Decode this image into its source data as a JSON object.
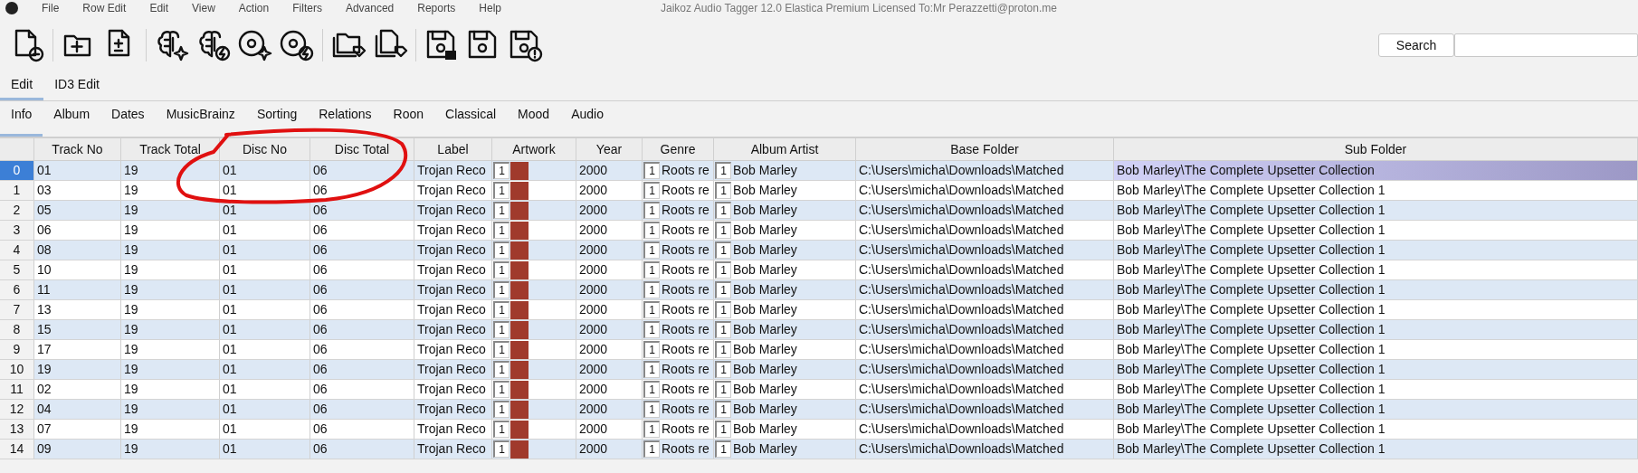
{
  "menu_bar": {
    "items": [
      "File",
      "Row Edit",
      "Edit",
      "View",
      "Action",
      "Filters",
      "Advanced",
      "Reports",
      "Help"
    ]
  },
  "window": {
    "title": "Jaikoz Audio Tagger 12.0 Elastica Premium Licensed To:Mr Perazzetti@proton.me"
  },
  "search": {
    "button": "Search"
  },
  "tabs": [
    {
      "label": "Edit",
      "selected": true
    },
    {
      "label": "ID3 Edit",
      "selected": false
    }
  ],
  "subtabs": [
    {
      "label": "Info",
      "selected": true
    },
    {
      "label": "Album",
      "selected": false
    },
    {
      "label": "Dates",
      "selected": false
    },
    {
      "label": "MusicBrainz",
      "selected": false
    },
    {
      "label": "Sorting",
      "selected": false
    },
    {
      "label": "Relations",
      "selected": false
    },
    {
      "label": "Roon",
      "selected": false
    },
    {
      "label": "Classical",
      "selected": false
    },
    {
      "label": "Mood",
      "selected": false
    },
    {
      "label": "Audio",
      "selected": false
    }
  ],
  "table": {
    "columns": [
      "Track No",
      "Track Total",
      "Disc No",
      "Disc Total",
      "Label",
      "Artwork",
      "Year",
      "Genre",
      "Album Artist",
      "Base Folder",
      "Sub Folder"
    ],
    "rows": [
      {
        "number": "0",
        "track_no": "01",
        "track_total": "19",
        "disc_no": "01",
        "disc_total": "06",
        "label": "Trojan Reco",
        "artwork_count": "1",
        "year": "2000",
        "genre_count": "1",
        "genre": "Roots re",
        "album_artist_count": "1",
        "album_artist": "Bob Marley",
        "base_folder": "C:\\Users\\micha\\Downloads\\Matched",
        "sub_folder": "Bob Marley\\The Complete Upsetter Collection",
        "selected": true
      },
      {
        "number": "1",
        "track_no": "03",
        "track_total": "19",
        "disc_no": "01",
        "disc_total": "06",
        "label": "Trojan Reco",
        "artwork_count": "1",
        "year": "2000",
        "genre_count": "1",
        "genre": "Roots re",
        "album_artist_count": "1",
        "album_artist": "Bob Marley",
        "base_folder": "C:\\Users\\micha\\Downloads\\Matched",
        "sub_folder": "Bob Marley\\The Complete Upsetter Collection 1",
        "selected": false
      },
      {
        "number": "2",
        "track_no": "05",
        "track_total": "19",
        "disc_no": "01",
        "disc_total": "06",
        "label": "Trojan Reco",
        "artwork_count": "1",
        "year": "2000",
        "genre_count": "1",
        "genre": "Roots re",
        "album_artist_count": "1",
        "album_artist": "Bob Marley",
        "base_folder": "C:\\Users\\micha\\Downloads\\Matched",
        "sub_folder": "Bob Marley\\The Complete Upsetter Collection 1",
        "selected": false
      },
      {
        "number": "3",
        "track_no": "06",
        "track_total": "19",
        "disc_no": "01",
        "disc_total": "06",
        "label": "Trojan Reco",
        "artwork_count": "1",
        "year": "2000",
        "genre_count": "1",
        "genre": "Roots re",
        "album_artist_count": "1",
        "album_artist": "Bob Marley",
        "base_folder": "C:\\Users\\micha\\Downloads\\Matched",
        "sub_folder": "Bob Marley\\The Complete Upsetter Collection 1",
        "selected": false
      },
      {
        "number": "4",
        "track_no": "08",
        "track_total": "19",
        "disc_no": "01",
        "disc_total": "06",
        "label": "Trojan Reco",
        "artwork_count": "1",
        "year": "2000",
        "genre_count": "1",
        "genre": "Roots re",
        "album_artist_count": "1",
        "album_artist": "Bob Marley",
        "base_folder": "C:\\Users\\micha\\Downloads\\Matched",
        "sub_folder": "Bob Marley\\The Complete Upsetter Collection 1",
        "selected": false
      },
      {
        "number": "5",
        "track_no": "10",
        "track_total": "19",
        "disc_no": "01",
        "disc_total": "06",
        "label": "Trojan Reco",
        "artwork_count": "1",
        "year": "2000",
        "genre_count": "1",
        "genre": "Roots re",
        "album_artist_count": "1",
        "album_artist": "Bob Marley",
        "base_folder": "C:\\Users\\micha\\Downloads\\Matched",
        "sub_folder": "Bob Marley\\The Complete Upsetter Collection 1",
        "selected": false
      },
      {
        "number": "6",
        "track_no": "11",
        "track_total": "19",
        "disc_no": "01",
        "disc_total": "06",
        "label": "Trojan Reco",
        "artwork_count": "1",
        "year": "2000",
        "genre_count": "1",
        "genre": "Roots re",
        "album_artist_count": "1",
        "album_artist": "Bob Marley",
        "base_folder": "C:\\Users\\micha\\Downloads\\Matched",
        "sub_folder": "Bob Marley\\The Complete Upsetter Collection 1",
        "selected": false
      },
      {
        "number": "7",
        "track_no": "13",
        "track_total": "19",
        "disc_no": "01",
        "disc_total": "06",
        "label": "Trojan Reco",
        "artwork_count": "1",
        "year": "2000",
        "genre_count": "1",
        "genre": "Roots re",
        "album_artist_count": "1",
        "album_artist": "Bob Marley",
        "base_folder": "C:\\Users\\micha\\Downloads\\Matched",
        "sub_folder": "Bob Marley\\The Complete Upsetter Collection 1",
        "selected": false
      },
      {
        "number": "8",
        "track_no": "15",
        "track_total": "19",
        "disc_no": "01",
        "disc_total": "06",
        "label": "Trojan Reco",
        "artwork_count": "1",
        "year": "2000",
        "genre_count": "1",
        "genre": "Roots re",
        "album_artist_count": "1",
        "album_artist": "Bob Marley",
        "base_folder": "C:\\Users\\micha\\Downloads\\Matched",
        "sub_folder": "Bob Marley\\The Complete Upsetter Collection 1",
        "selected": false
      },
      {
        "number": "9",
        "track_no": "17",
        "track_total": "19",
        "disc_no": "01",
        "disc_total": "06",
        "label": "Trojan Reco",
        "artwork_count": "1",
        "year": "2000",
        "genre_count": "1",
        "genre": "Roots re",
        "album_artist_count": "1",
        "album_artist": "Bob Marley",
        "base_folder": "C:\\Users\\micha\\Downloads\\Matched",
        "sub_folder": "Bob Marley\\The Complete Upsetter Collection 1",
        "selected": false
      },
      {
        "number": "10",
        "track_no": "19",
        "track_total": "19",
        "disc_no": "01",
        "disc_total": "06",
        "label": "Trojan Reco",
        "artwork_count": "1",
        "year": "2000",
        "genre_count": "1",
        "genre": "Roots re",
        "album_artist_count": "1",
        "album_artist": "Bob Marley",
        "base_folder": "C:\\Users\\micha\\Downloads\\Matched",
        "sub_folder": "Bob Marley\\The Complete Upsetter Collection 1",
        "selected": false
      },
      {
        "number": "11",
        "track_no": "02",
        "track_total": "19",
        "disc_no": "01",
        "disc_total": "06",
        "label": "Trojan Reco",
        "artwork_count": "1",
        "year": "2000",
        "genre_count": "1",
        "genre": "Roots re",
        "album_artist_count": "1",
        "album_artist": "Bob Marley",
        "base_folder": "C:\\Users\\micha\\Downloads\\Matched",
        "sub_folder": "Bob Marley\\The Complete Upsetter Collection 1",
        "selected": false
      },
      {
        "number": "12",
        "track_no": "04",
        "track_total": "19",
        "disc_no": "01",
        "disc_total": "06",
        "label": "Trojan Reco",
        "artwork_count": "1",
        "year": "2000",
        "genre_count": "1",
        "genre": "Roots re",
        "album_artist_count": "1",
        "album_artist": "Bob Marley",
        "base_folder": "C:\\Users\\micha\\Downloads\\Matched",
        "sub_folder": "Bob Marley\\The Complete Upsetter Collection 1",
        "selected": false
      },
      {
        "number": "13",
        "track_no": "07",
        "track_total": "19",
        "disc_no": "01",
        "disc_total": "06",
        "label": "Trojan Reco",
        "artwork_count": "1",
        "year": "2000",
        "genre_count": "1",
        "genre": "Roots re",
        "album_artist_count": "1",
        "album_artist": "Bob Marley",
        "base_folder": "C:\\Users\\micha\\Downloads\\Matched",
        "sub_folder": "Bob Marley\\The Complete Upsetter Collection 1",
        "selected": false
      },
      {
        "number": "14",
        "track_no": "09",
        "track_total": "19",
        "disc_no": "01",
        "disc_total": "06",
        "label": "Trojan Reco",
        "artwork_count": "1",
        "year": "2000",
        "genre_count": "1",
        "genre": "Roots re",
        "album_artist_count": "1",
        "album_artist": "Bob Marley",
        "base_folder": "C:\\Users\\micha\\Downloads\\Matched",
        "sub_folder": "Bob Marley\\The Complete Upsetter Collection 1",
        "selected": false
      }
    ]
  }
}
